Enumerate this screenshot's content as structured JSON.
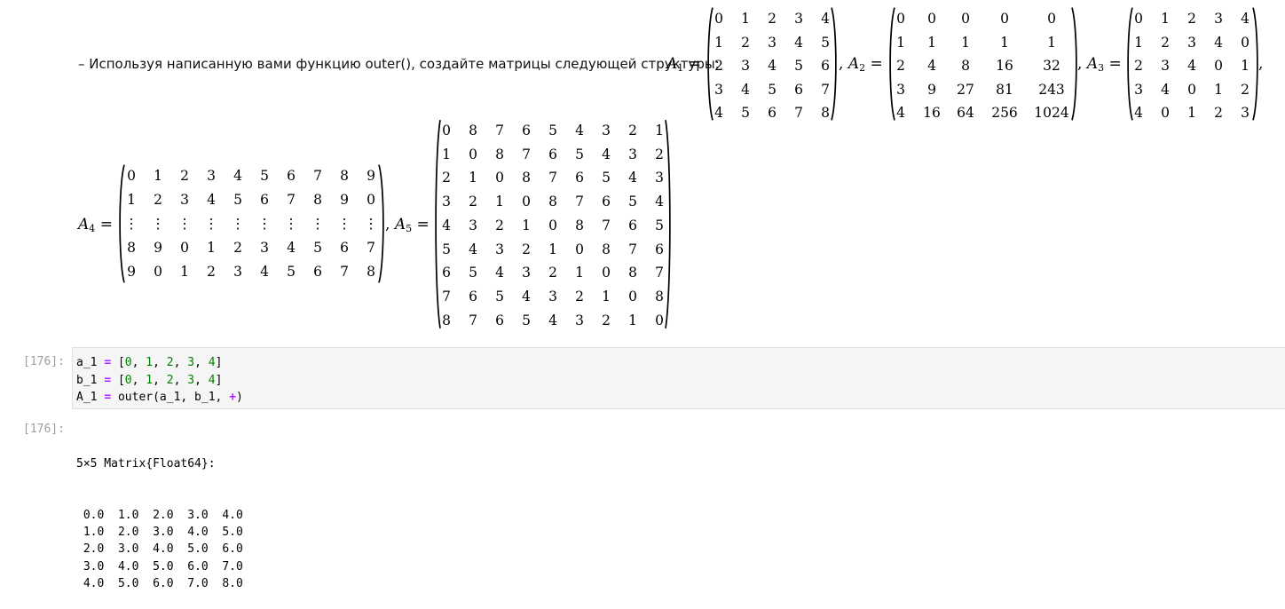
{
  "markdown": {
    "instruction": "– Используя написанную вами функцию outer(), создайте матрицы следующей структуры:",
    "labels": [
      {
        "name": "A",
        "sub": "1"
      },
      {
        "name": "A",
        "sub": "2"
      },
      {
        "name": "A",
        "sub": "3"
      },
      {
        "name": "A",
        "sub": "4"
      },
      {
        "name": "A",
        "sub": "5"
      }
    ],
    "equals": "=",
    "separator": ",",
    "matrices": {
      "A1": [
        [
          "0",
          "1",
          "2",
          "3",
          "4"
        ],
        [
          "1",
          "2",
          "3",
          "4",
          "5"
        ],
        [
          "2",
          "3",
          "4",
          "5",
          "6"
        ],
        [
          "3",
          "4",
          "5",
          "6",
          "7"
        ],
        [
          "4",
          "5",
          "6",
          "7",
          "8"
        ]
      ],
      "A2": [
        [
          "0",
          "0",
          "0",
          "0",
          "0"
        ],
        [
          "1",
          "1",
          "1",
          "1",
          "1"
        ],
        [
          "2",
          "4",
          "8",
          "16",
          "32"
        ],
        [
          "3",
          "9",
          "27",
          "81",
          "243"
        ],
        [
          "4",
          "16",
          "64",
          "256",
          "1024"
        ]
      ],
      "A3": [
        [
          "0",
          "1",
          "2",
          "3",
          "4"
        ],
        [
          "1",
          "2",
          "3",
          "4",
          "0"
        ],
        [
          "2",
          "3",
          "4",
          "0",
          "1"
        ],
        [
          "3",
          "4",
          "0",
          "1",
          "2"
        ],
        [
          "4",
          "0",
          "1",
          "2",
          "3"
        ]
      ],
      "A4": [
        [
          "0",
          "1",
          "2",
          "3",
          "4",
          "5",
          "6",
          "7",
          "8",
          "9"
        ],
        [
          "1",
          "2",
          "3",
          "4",
          "5",
          "6",
          "7",
          "8",
          "9",
          "0"
        ],
        [
          "⋮",
          "⋮",
          "⋮",
          "⋮",
          "⋮",
          "⋮",
          "⋮",
          "⋮",
          "⋮",
          "⋮"
        ],
        [
          "8",
          "9",
          "0",
          "1",
          "2",
          "3",
          "4",
          "5",
          "6",
          "7"
        ],
        [
          "9",
          "0",
          "1",
          "2",
          "3",
          "4",
          "5",
          "6",
          "7",
          "8"
        ]
      ],
      "A5": [
        [
          "0",
          "8",
          "7",
          "6",
          "5",
          "4",
          "3",
          "2",
          "1"
        ],
        [
          "1",
          "0",
          "8",
          "7",
          "6",
          "5",
          "4",
          "3",
          "2"
        ],
        [
          "2",
          "1",
          "0",
          "8",
          "7",
          "6",
          "5",
          "4",
          "3"
        ],
        [
          "3",
          "2",
          "1",
          "0",
          "8",
          "7",
          "6",
          "5",
          "4"
        ],
        [
          "4",
          "3",
          "2",
          "1",
          "0",
          "8",
          "7",
          "6",
          "5"
        ],
        [
          "5",
          "4",
          "3",
          "2",
          "1",
          "0",
          "8",
          "7",
          "6"
        ],
        [
          "6",
          "5",
          "4",
          "3",
          "2",
          "1",
          "0",
          "8",
          "7"
        ],
        [
          "7",
          "6",
          "5",
          "4",
          "3",
          "2",
          "1",
          "0",
          "8"
        ],
        [
          "8",
          "7",
          "6",
          "5",
          "4",
          "3",
          "2",
          "1",
          "0"
        ]
      ]
    }
  },
  "code_cell": {
    "prompt": "[176]:",
    "lines": [
      [
        {
          "t": "a_1 ",
          "c": ""
        },
        {
          "t": "=",
          "c": "op"
        },
        {
          "t": " [",
          "c": ""
        },
        {
          "t": "0",
          "c": "num"
        },
        {
          "t": ", ",
          "c": ""
        },
        {
          "t": "1",
          "c": "num"
        },
        {
          "t": ", ",
          "c": ""
        },
        {
          "t": "2",
          "c": "num"
        },
        {
          "t": ", ",
          "c": ""
        },
        {
          "t": "3",
          "c": "num"
        },
        {
          "t": ", ",
          "c": ""
        },
        {
          "t": "4",
          "c": "num"
        },
        {
          "t": "]",
          "c": ""
        }
      ],
      [
        {
          "t": "b_1 ",
          "c": ""
        },
        {
          "t": "=",
          "c": "op"
        },
        {
          "t": " [",
          "c": ""
        },
        {
          "t": "0",
          "c": "num"
        },
        {
          "t": ", ",
          "c": ""
        },
        {
          "t": "1",
          "c": "num"
        },
        {
          "t": ", ",
          "c": ""
        },
        {
          "t": "2",
          "c": "num"
        },
        {
          "t": ", ",
          "c": ""
        },
        {
          "t": "3",
          "c": "num"
        },
        {
          "t": ", ",
          "c": ""
        },
        {
          "t": "4",
          "c": "num"
        },
        {
          "t": "]",
          "c": ""
        }
      ],
      [
        {
          "t": "A_1 ",
          "c": ""
        },
        {
          "t": "=",
          "c": "op"
        },
        {
          "t": " outer(a_1, b_1, ",
          "c": ""
        },
        {
          "t": "+",
          "c": "op"
        },
        {
          "t": ")",
          "c": ""
        }
      ]
    ]
  },
  "output_cell": {
    "prompt": "[176]:",
    "header": "5×5 Matrix{Float64}:",
    "rows": [
      " 0.0  1.0  2.0  3.0  4.0",
      " 1.0  2.0  3.0  4.0  5.0",
      " 2.0  3.0  4.0  5.0  6.0",
      " 3.0  4.0  5.0  6.0  7.0",
      " 4.0  5.0  6.0  7.0  8.0"
    ]
  },
  "colors": {
    "operator": "#aa22ff",
    "number": "#008000",
    "prompt": "#9e9e9e",
    "code_bg": "#f5f5f5"
  }
}
